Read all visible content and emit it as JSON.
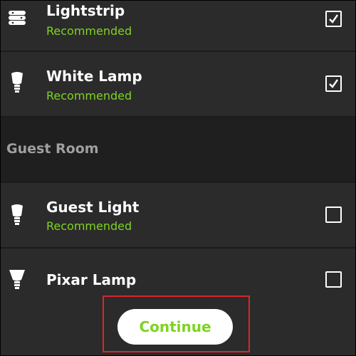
{
  "rows": [
    {
      "name": "Lightstrip",
      "subtitle": "Recommended",
      "checked": true,
      "icon": "lightstrip-icon"
    },
    {
      "name": "White Lamp",
      "subtitle": "Recommended",
      "checked": true,
      "icon": "bulb-icon"
    }
  ],
  "section": {
    "title": "Guest Room"
  },
  "guest_rows": [
    {
      "name": "Guest Light",
      "subtitle": "Recommended",
      "checked": false,
      "icon": "bulb-icon"
    },
    {
      "name": "Pixar Lamp",
      "checked": false,
      "icon": "spot-bulb-icon"
    }
  ],
  "continue_label": "Continue",
  "colors": {
    "accent": "#7ed321",
    "highlight_border": "#d9262a"
  }
}
